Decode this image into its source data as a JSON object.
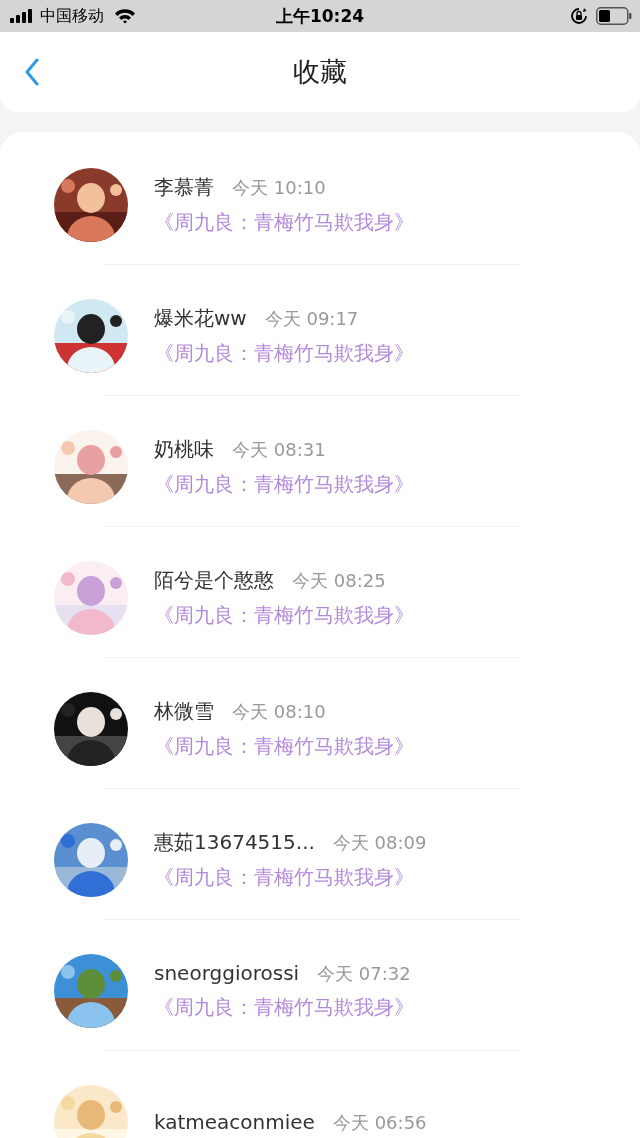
{
  "status_bar": {
    "carrier": "中国移动",
    "time": "上午10:24"
  },
  "header": {
    "title": "收藏"
  },
  "items": [
    {
      "name": "李慕菁",
      "time": "今天 10:10",
      "book": "《周九良：青梅竹马欺我身》"
    },
    {
      "name": "爆米花ww",
      "time": "今天 09:17",
      "book": "《周九良：青梅竹马欺我身》"
    },
    {
      "name": "奶桃味",
      "time": "今天 08:31",
      "book": "《周九良：青梅竹马欺我身》"
    },
    {
      "name": "陌兮是个憨憨",
      "time": "今天 08:25",
      "book": "《周九良：青梅竹马欺我身》"
    },
    {
      "name": "林微雪",
      "time": "今天 08:10",
      "book": "《周九良：青梅竹马欺我身》"
    },
    {
      "name": "惠茹13674515...",
      "time": "今天 08:09",
      "book": "《周九良：青梅竹马欺我身》"
    },
    {
      "name": "sneorggiorossi",
      "time": "今天 07:32",
      "book": "《周九良：青梅竹马欺我身》"
    },
    {
      "name": "katmeaconmiee",
      "time": "今天 06:56"
    }
  ]
}
